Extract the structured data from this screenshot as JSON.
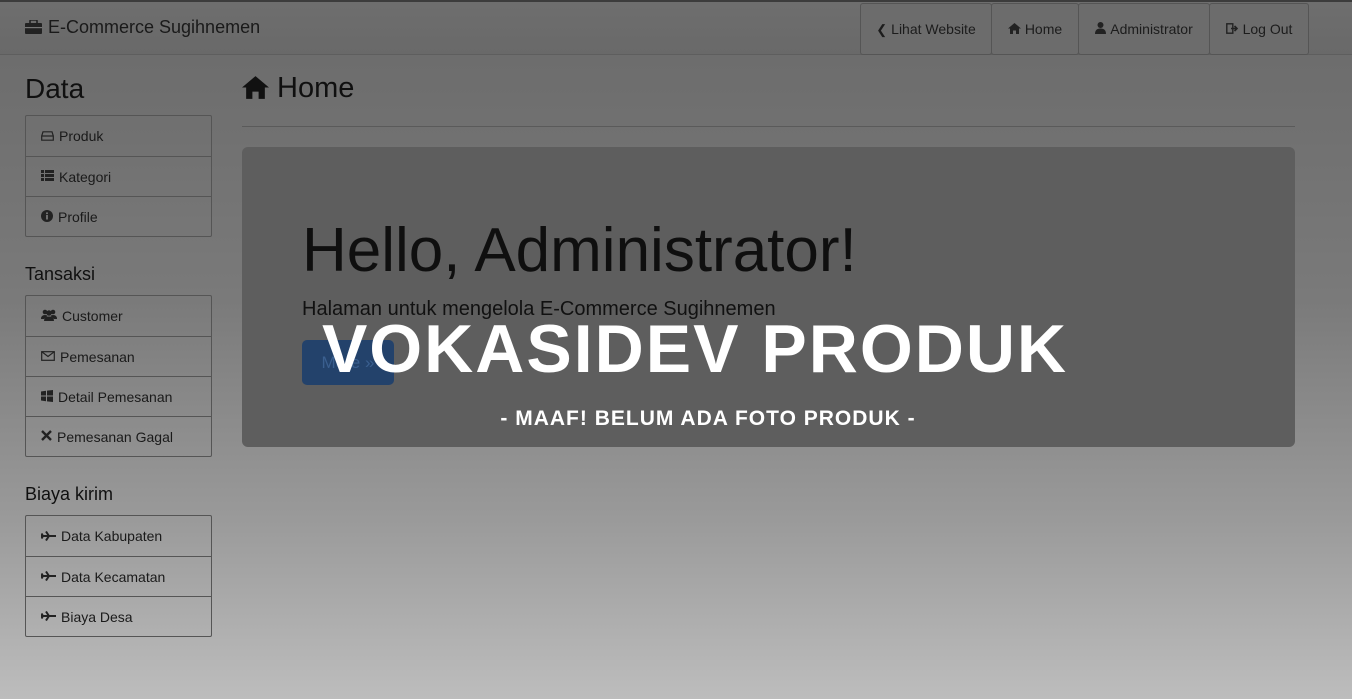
{
  "navbar": {
    "brand": "E-Commerce Sugihnemen",
    "brand_icon": "briefcase-icon",
    "buttons": [
      {
        "label": "Lihat Website",
        "icon": "chevron-left-icon"
      },
      {
        "label": "Home",
        "icon": "home-icon"
      },
      {
        "label": "Administrator",
        "icon": "user-icon"
      },
      {
        "label": "Log Out",
        "icon": "logout-icon"
      }
    ]
  },
  "sidebar": {
    "data_title": "Data",
    "data_items": [
      {
        "label": "Produk",
        "icon": "hdd-icon"
      },
      {
        "label": "Kategori",
        "icon": "list-icon"
      },
      {
        "label": "Profile",
        "icon": "info-icon"
      }
    ],
    "transaksi_title": "Tansaksi",
    "transaksi_items": [
      {
        "label": "Customer",
        "icon": "users-icon"
      },
      {
        "label": "Pemesanan",
        "icon": "envelope-icon"
      },
      {
        "label": "Detail Pemesanan",
        "icon": "windows-icon"
      },
      {
        "label": "Pemesanan Gagal",
        "icon": "close-icon"
      }
    ],
    "biaya_title": "Biaya kirim",
    "biaya_items": [
      {
        "label": "Data Kabupaten",
        "icon": "plane-icon"
      },
      {
        "label": "Data Kecamatan",
        "icon": "plane-icon"
      },
      {
        "label": "Biaya Desa",
        "icon": "plane-icon"
      }
    ]
  },
  "main": {
    "title": "Home",
    "greeting": "Hello, Administrator!",
    "lead": "Halaman untuk mengelola E-Commerce Sugihnemen",
    "more_button": "More »"
  },
  "overlay": {
    "title": "VOKASIDEV PRODUK",
    "subtitle": "- MAAF! BELUM ADA FOTO PRODUK -"
  },
  "colors": {
    "button_primary": "#23426b",
    "overlay_text": "#ffffff"
  }
}
